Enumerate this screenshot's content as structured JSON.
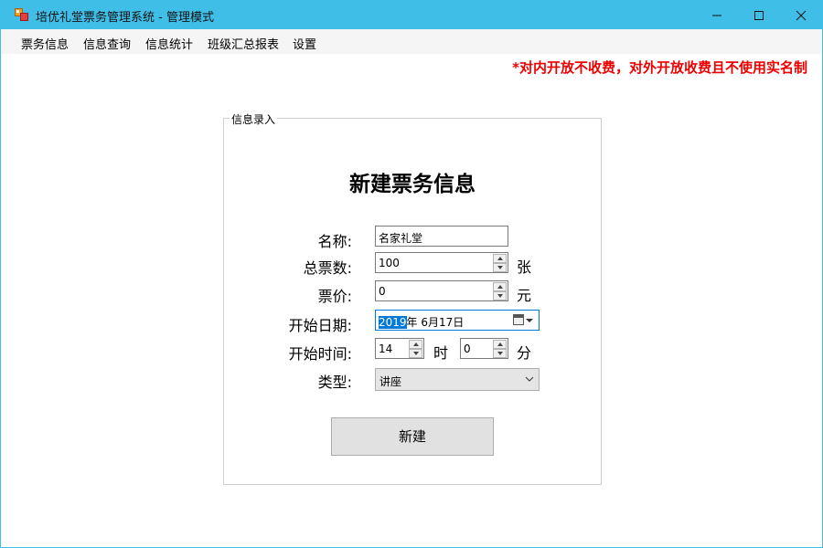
{
  "window": {
    "title": "培优礼堂票务管理系统 - 管理模式"
  },
  "menu": {
    "items": [
      "票务信息",
      "信息查询",
      "信息统计",
      "班级汇总报表",
      "设置"
    ]
  },
  "notice": "*对内开放不收费，对外开放收费且不使用实名制",
  "form": {
    "group_label": "信息录入",
    "heading": "新建票务信息",
    "name_label": "名称:",
    "name_value": "名家礼堂",
    "total_label": "总票数:",
    "total_value": "100",
    "total_unit": "张",
    "price_label": "票价:",
    "price_value": "0",
    "price_unit": "元",
    "date_label": "开始日期:",
    "date_year": "2019",
    "date_rest": "年  6月17日",
    "time_label": "开始时间:",
    "hour_value": "14",
    "hour_unit": "时",
    "minute_value": "0",
    "minute_unit": "分",
    "type_label": "类型:",
    "type_value": "讲座",
    "submit_label": "新建"
  },
  "colors": {
    "titlebar": "#3fbfe8",
    "notice": "#ee0000",
    "selection": "#0078d7"
  }
}
